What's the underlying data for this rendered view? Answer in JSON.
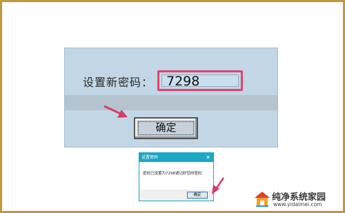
{
  "password_dialog": {
    "label": "设置新密码：",
    "password_value": "7298",
    "ok_label": "确定"
  },
  "message_dialog": {
    "title": "设置密码",
    "close_glyph": "✕",
    "message": "密码已设置为7298请记好您的密码",
    "ok_label": "确定"
  },
  "watermark": {
    "title": "纯净系统家园",
    "url": "www.yidaimei.com"
  },
  "colors": {
    "frame_border": "#c4963a",
    "highlight": "#e0436f",
    "panel_bg": "#c2d6e5",
    "msg_title_bg": "#1aa8c4"
  }
}
